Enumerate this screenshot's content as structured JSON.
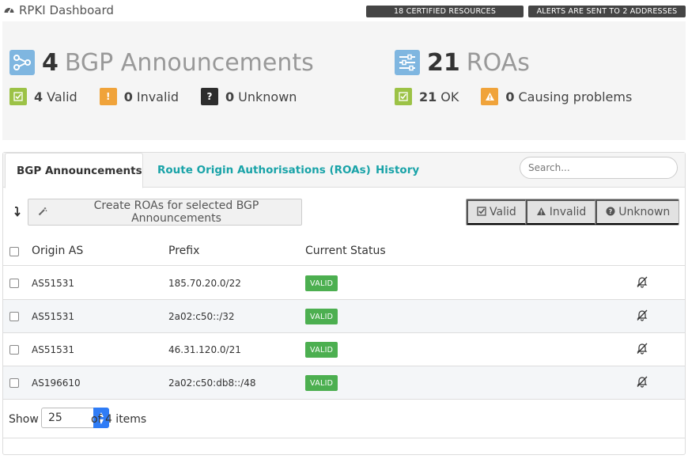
{
  "header": {
    "title": "RPKI Dashboard",
    "certified_badge": "18 CERTIFIED RESOURCES",
    "alerts_badge": "ALERTS ARE SENT TO 2 ADDRESSES"
  },
  "summary": {
    "bgp": {
      "count": "4",
      "label": "BGP Announcements",
      "stats": [
        {
          "count": "4",
          "label": "Valid"
        },
        {
          "count": "0",
          "label": "Invalid"
        },
        {
          "count": "0",
          "label": "Unknown"
        }
      ]
    },
    "roas": {
      "count": "21",
      "label": "ROAs",
      "stats": [
        {
          "count": "21",
          "label": "OK"
        },
        {
          "count": "0",
          "label": "Causing problems"
        }
      ]
    }
  },
  "tabs": [
    {
      "label": "BGP Announcements"
    },
    {
      "label": "Route Origin Authorisations (ROAs)"
    },
    {
      "label": "History"
    }
  ],
  "search": {
    "placeholder": "Search..."
  },
  "toolbar": {
    "create_label": "Create ROAs for selected BGP Announcements",
    "filters": [
      {
        "label": "Valid"
      },
      {
        "label": "Invalid"
      },
      {
        "label": "Unknown"
      }
    ]
  },
  "table": {
    "headers": {
      "origin": "Origin AS",
      "prefix": "Prefix",
      "status": "Current Status"
    },
    "rows": [
      {
        "origin": "AS51531",
        "prefix": "185.70.20.0/22",
        "status": "VALID"
      },
      {
        "origin": "AS51531",
        "prefix": "2a02:c50::/32",
        "status": "VALID"
      },
      {
        "origin": "AS51531",
        "prefix": "46.31.120.0/21",
        "status": "VALID"
      },
      {
        "origin": "AS196610",
        "prefix": "2a02:c50:db8::/48",
        "status": "VALID"
      }
    ]
  },
  "pagination": {
    "show_label": "Show",
    "page_size": "25",
    "of_label": "of 4 items"
  },
  "colors": {
    "accent": "#19a3a8",
    "valid_badge": "#4caf50",
    "valid_square": "#9cc246",
    "invalid_square": "#f0a33a",
    "unknown_square": "#2d2d2d",
    "summary_icon": "#7fb6e0",
    "header_badge": "#454545"
  },
  "icons": {
    "title": "dashboard-gauge-icon",
    "bgp": "share-nodes-icon",
    "roas": "sliders-icon",
    "sort": "sort-arrow-icon",
    "create": "magic-wand-icon",
    "row_action": "bell-slash-icon"
  }
}
